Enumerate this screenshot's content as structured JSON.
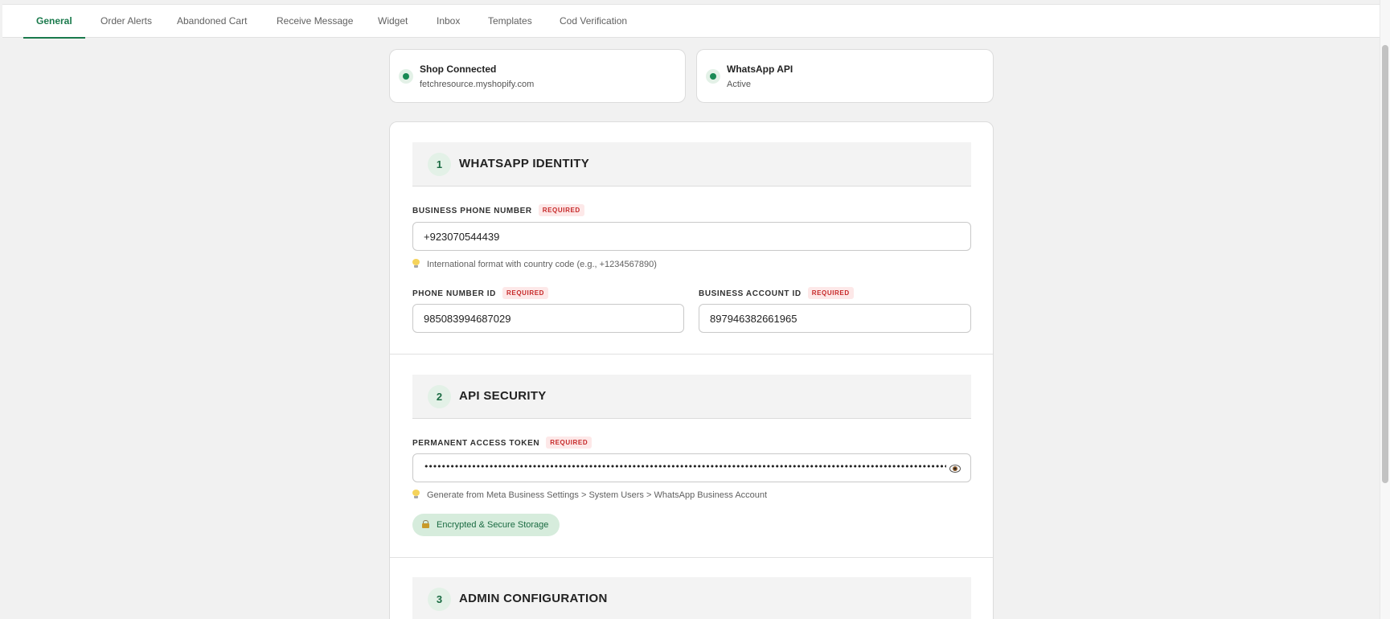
{
  "tabs": [
    {
      "label": "General",
      "active": true
    },
    {
      "label": "Order Alerts",
      "active": false
    },
    {
      "label": "Abandoned Cart",
      "active": false
    },
    {
      "label": "Receive Message",
      "active": false
    },
    {
      "label": "Widget",
      "active": false
    },
    {
      "label": "Inbox",
      "active": false
    },
    {
      "label": "Templates",
      "active": false
    },
    {
      "label": "Cod Verification",
      "active": false
    }
  ],
  "status": {
    "shop": {
      "title": "Shop Connected",
      "subtitle": "fetchresource.myshopify.com"
    },
    "api": {
      "title": "WhatsApp API",
      "subtitle": "Active"
    }
  },
  "required_badge": "REQUIRED",
  "sections": {
    "identity": {
      "number": "1",
      "title": "WHATSAPP IDENTITY"
    },
    "security": {
      "number": "2",
      "title": "API SECURITY"
    },
    "admin": {
      "number": "3",
      "title": "ADMIN CONFIGURATION"
    }
  },
  "fields": {
    "business_phone": {
      "label": "BUSINESS PHONE NUMBER",
      "value": "+923070544439",
      "hint": "International format with country code (e.g., +1234567890)"
    },
    "phone_number_id": {
      "label": "PHONE NUMBER ID",
      "value": "985083994687029"
    },
    "business_account_id": {
      "label": "BUSINESS ACCOUNT ID",
      "value": "897946382661965"
    },
    "access_token": {
      "label": "PERMANENT ACCESS TOKEN",
      "masked_value": "••••••••••••••••••••••••••••••••••••••••••••••••••••••••••••••••••••••••••••••••••••••••••••••••••••••••••••••••••••••••••••••••••••••••••••••••••••••••••••••••••••••••••••••••••••••••••••••••••••",
      "hint": "Generate from Meta Business Settings > System Users > WhatsApp Business Account"
    }
  },
  "secure_badge": "Encrypted & Secure Storage",
  "colors": {
    "accent": "#1a7a4c",
    "status_dot": "#1a8a55",
    "required": "#c62828"
  }
}
